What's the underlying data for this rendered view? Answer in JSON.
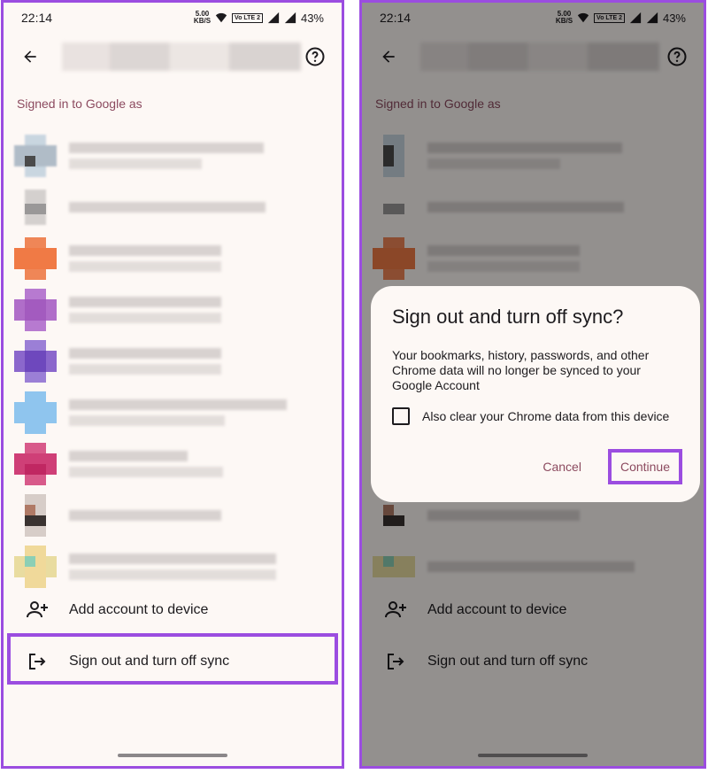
{
  "status": {
    "time": "22:14",
    "speed_value": "5.00",
    "speed_unit": "KB/S",
    "volte": "Vo LTE 2",
    "battery": "43%"
  },
  "screen": {
    "section_header": "Signed in to Google as",
    "add_account_label": "Add account to device",
    "sign_out_label": "Sign out and turn off sync"
  },
  "dialog": {
    "title": "Sign out and turn off sync?",
    "body": "Your bookmarks, history, passwords, and other Chrome data will no longer be synced to your Google Account",
    "checkbox_label": "Also clear your Chrome data from this device",
    "cancel_label": "Cancel",
    "continue_label": "Continue"
  },
  "colors": {
    "accent": "#8c4a5f",
    "highlight": "#9b4de0",
    "background": "#fdf8f5"
  },
  "icons": {
    "back": "arrow-left-icon",
    "help": "help-circle-icon",
    "add_account": "person-add-icon",
    "sign_out": "logout-icon"
  }
}
